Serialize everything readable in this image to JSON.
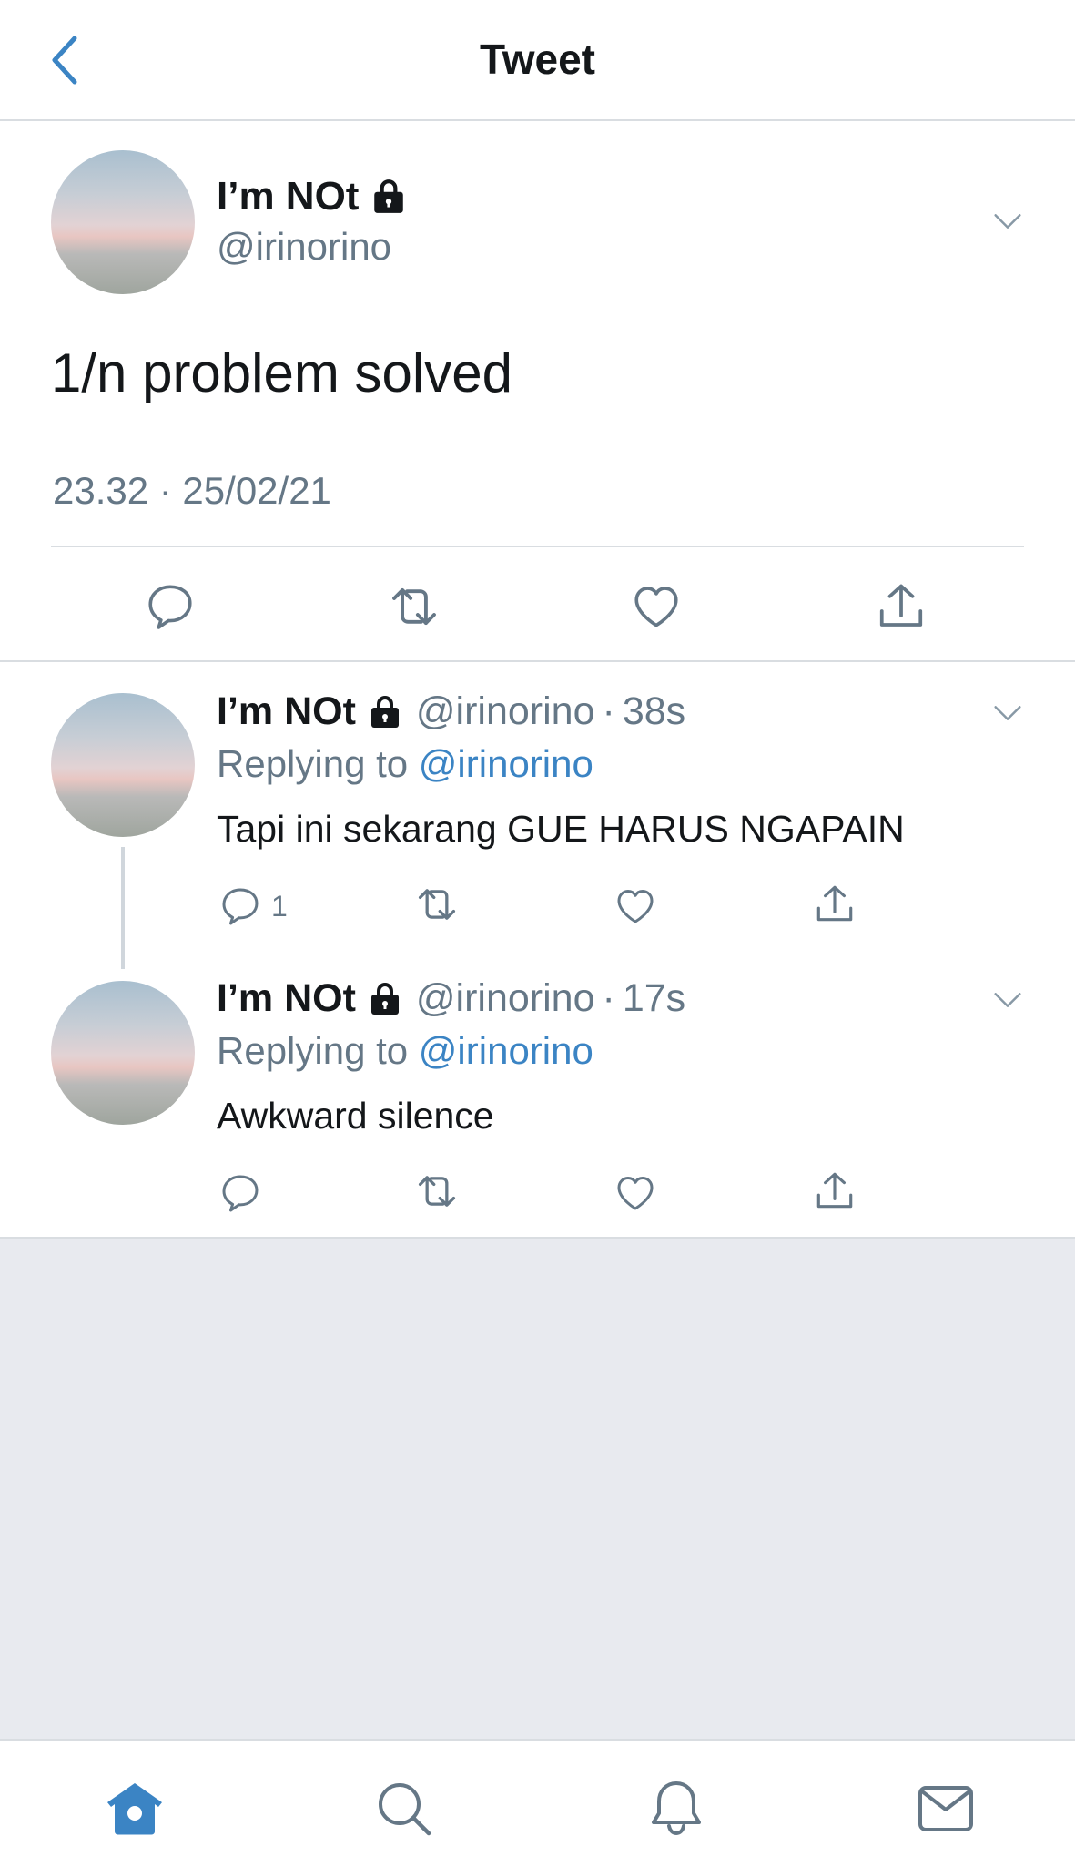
{
  "header": {
    "title": "Tweet"
  },
  "main_tweet": {
    "name": "I’m NOt",
    "handle": "@irinorino",
    "text": "1/n problem solved",
    "timestamp": "23.32 · 25/02/21"
  },
  "replies": [
    {
      "name": "I’m NOt",
      "handle": "@irinorino",
      "dot": "·",
      "time": "38s",
      "replying_prefix": "Replying to ",
      "replying_to": "@irinorino",
      "text": "Tapi ini sekarang GUE HARUS NGAPAIN",
      "reply_count": "1"
    },
    {
      "name": "I’m NOt",
      "handle": "@irinorino",
      "dot": "·",
      "time": "17s",
      "replying_prefix": "Replying to ",
      "replying_to": "@irinorino",
      "text": "Awkward silence",
      "reply_count": ""
    }
  ],
  "icons": {
    "back": "chevron-left-icon",
    "lock": "lock-icon",
    "more": "chevron-down-icon",
    "reply": "comment-icon",
    "retweet": "retweet-icon",
    "like": "heart-icon",
    "share": "share-icon",
    "tabs": [
      "home-icon",
      "search-icon",
      "bell-icon",
      "mail-icon"
    ]
  },
  "colors": {
    "accent": "#3b84c4",
    "secondary_text": "#657786",
    "primary_text": "#14171a",
    "empty_background": "#e8eaef"
  }
}
